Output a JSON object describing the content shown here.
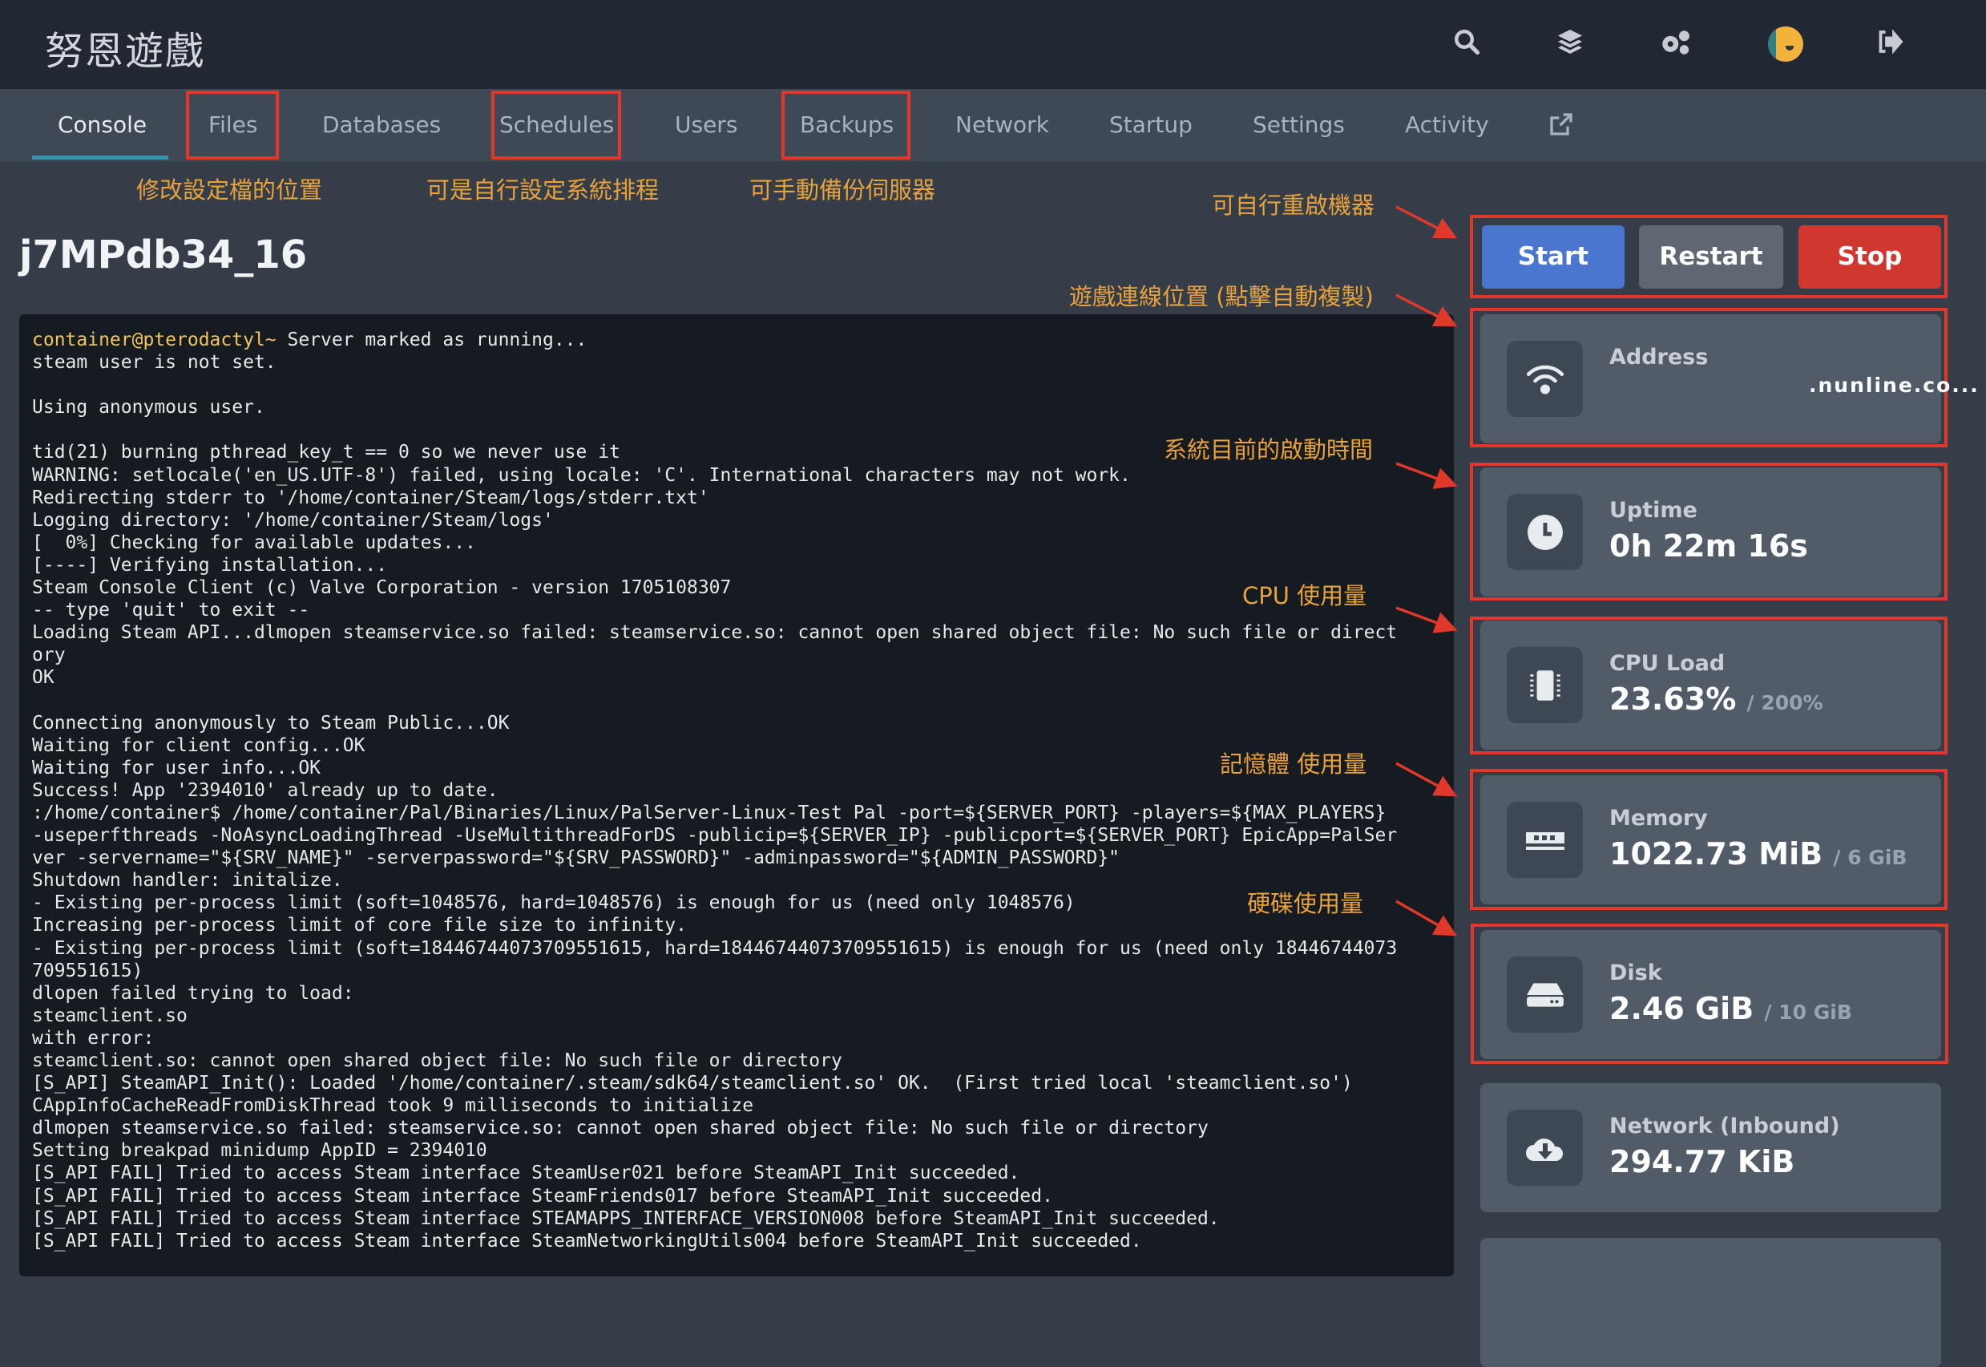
{
  "header": {
    "brand": "努恩遊戲",
    "icons": [
      "search-icon",
      "layers-icon",
      "gears-icon",
      "avatar",
      "sign-out-icon"
    ]
  },
  "nav": {
    "tabs": [
      "Console",
      "Files",
      "Databases",
      "Schedules",
      "Users",
      "Backups",
      "Network",
      "Startup",
      "Settings",
      "Activity"
    ],
    "active": "Console",
    "external_icon": "external-link-icon"
  },
  "annotations": {
    "files": "修改設定檔的位置",
    "schedules": "可是自行設定系統排程",
    "backups": "可手動備份伺服器",
    "power": "可自行重啟機器",
    "address": "遊戲連線位置 (點擊自動複製)",
    "uptime": "系統目前的啟動時間",
    "cpu": "CPU 使用量",
    "memory": "記憶體 使用量",
    "disk": "硬碟使用量"
  },
  "server": {
    "name": "j7MPdb34_16"
  },
  "console": {
    "prompt": "container@pterodactyl~",
    "first": " Server marked as running...",
    "lines": [
      "steam user is not set.",
      "",
      "Using anonymous user.",
      "",
      "tid(21) burning pthread_key_t == 0 so we never use it",
      "WARNING: setlocale('en_US.UTF-8') failed, using locale: 'C'. International characters may not work.",
      "Redirecting stderr to '/home/container/Steam/logs/stderr.txt'",
      "Logging directory: '/home/container/Steam/logs'",
      "[  0%] Checking for available updates...",
      "[----] Verifying installation...",
      "Steam Console Client (c) Valve Corporation - version 1705108307",
      "-- type 'quit' to exit --",
      "Loading Steam API...dlmopen steamservice.so failed: steamservice.so: cannot open shared object file: No such file or direct",
      "ory",
      "OK",
      "",
      "Connecting anonymously to Steam Public...OK",
      "Waiting for client config...OK",
      "Waiting for user info...OK",
      "Success! App '2394010' already up to date.",
      ":/home/container$ /home/container/Pal/Binaries/Linux/PalServer-Linux-Test Pal -port=${SERVER_PORT} -players=${MAX_PLAYERS}",
      "-useperfthreads -NoAsyncLoadingThread -UseMultithreadForDS -publicip=${SERVER_IP} -publicport=${SERVER_PORT} EpicApp=PalSer",
      "ver -servername=\"${SRV_NAME}\" -serverpassword=\"${SRV_PASSWORD}\" -adminpassword=\"${ADMIN_PASSWORD}\"",
      "Shutdown handler: initalize.",
      "- Existing per-process limit (soft=1048576, hard=1048576) is enough for us (need only 1048576)",
      "Increasing per-process limit of core file size to infinity.",
      "- Existing per-process limit (soft=18446744073709551615, hard=18446744073709551615) is enough for us (need only 18446744073",
      "709551615)",
      "dlopen failed trying to load:",
      "steamclient.so",
      "with error:",
      "steamclient.so: cannot open shared object file: No such file or directory",
      "[S_API] SteamAPI_Init(): Loaded '/home/container/.steam/sdk64/steamclient.so' OK.  (First tried local 'steamclient.so')",
      "CAppInfoCacheReadFromDiskThread took 9 milliseconds to initialize",
      "dlmopen steamservice.so failed: steamservice.so: cannot open shared object file: No such file or directory",
      "Setting breakpad minidump AppID = 2394010",
      "[S_API FAIL] Tried to access Steam interface SteamUser021 before SteamAPI_Init succeeded.",
      "[S_API FAIL] Tried to access Steam interface SteamFriends017 before SteamAPI_Init succeeded.",
      "[S_API FAIL] Tried to access Steam interface STEAMAPPS_INTERFACE_VERSION008 before SteamAPI_Init succeeded.",
      "[S_API FAIL] Tried to access Steam interface SteamNetworkingUtils004 before SteamAPI_Init succeeded."
    ]
  },
  "power": {
    "start": "Start",
    "restart": "Restart",
    "stop": "Stop",
    "colors": {
      "start": "#4a76cf",
      "restart": "#5e6772",
      "stop": "#d0382f"
    }
  },
  "stats": {
    "address": {
      "label": "Address",
      "value": ".nunline.co..."
    },
    "uptime": {
      "label": "Uptime",
      "value": "0h 22m 16s"
    },
    "cpu": {
      "label": "CPU Load",
      "value": "23.63%",
      "limit": "/ 200%"
    },
    "memory": {
      "label": "Memory",
      "value": "1022.73 MiB",
      "limit": "/ 6 GiB"
    },
    "disk": {
      "label": "Disk",
      "value": "2.46 GiB",
      "limit": "/ 10 GiB"
    },
    "network": {
      "label": "Network (Inbound)",
      "value": "294.77 KiB"
    }
  }
}
